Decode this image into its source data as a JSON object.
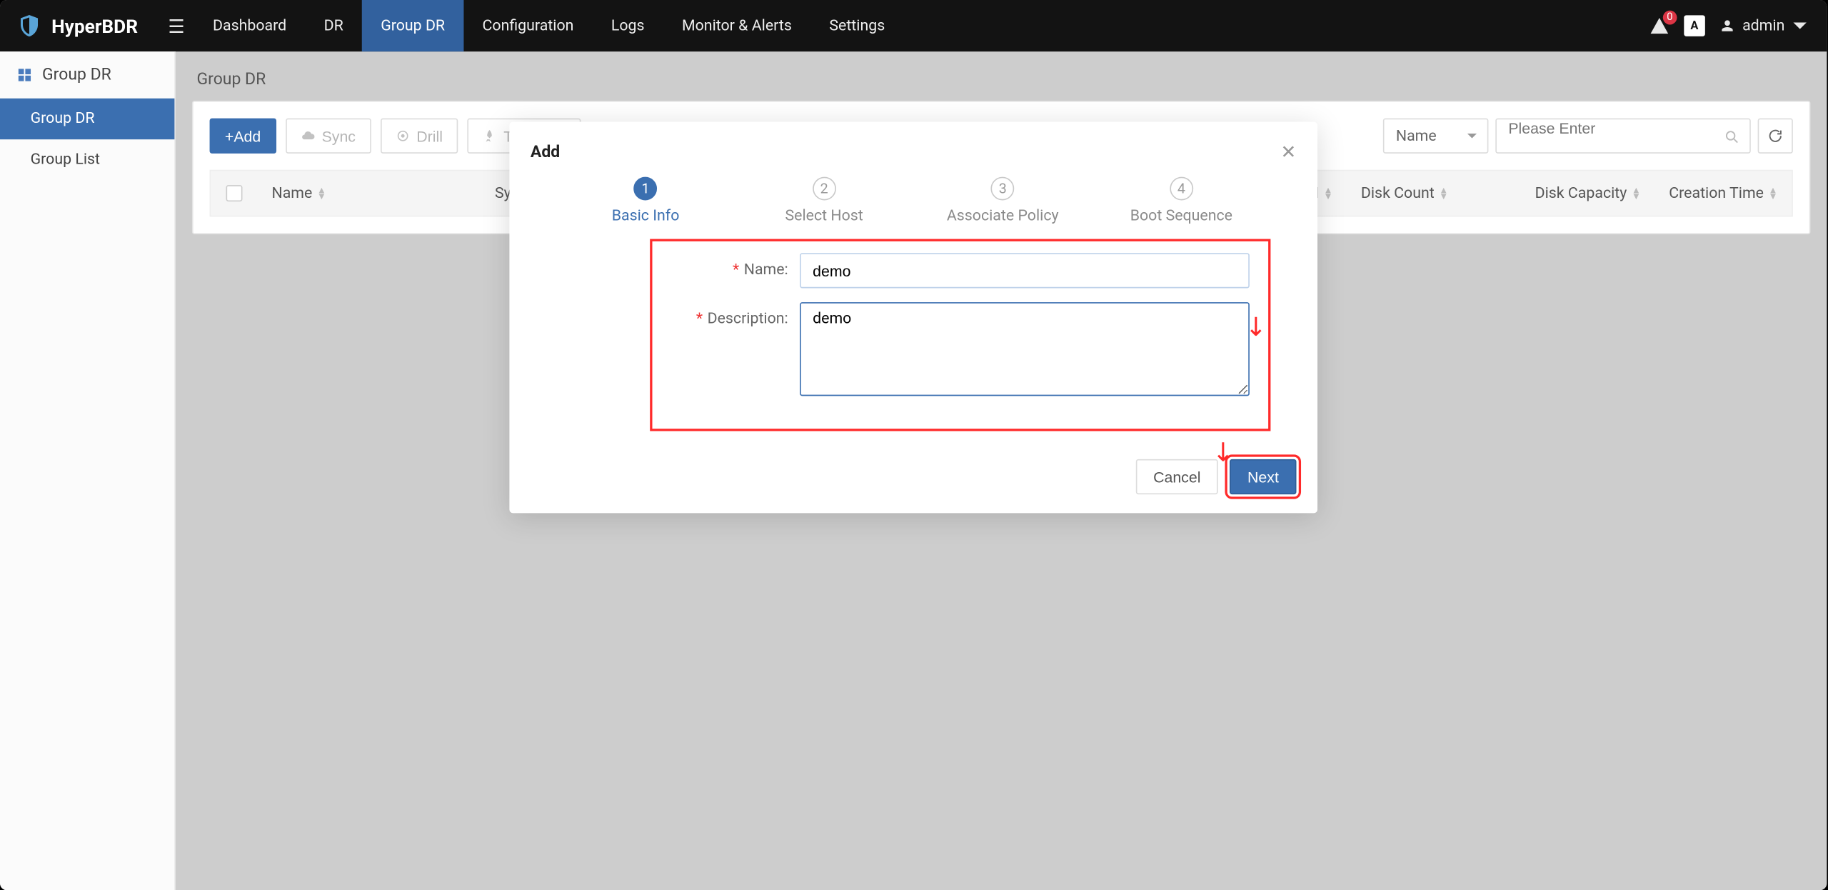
{
  "brand": "HyperBDR",
  "nav": {
    "items": [
      "Dashboard",
      "DR",
      "Group DR",
      "Configuration",
      "Logs",
      "Monitor & Alerts",
      "Settings"
    ],
    "activeIndex": 2
  },
  "topRight": {
    "alertCount": "0",
    "langLabel": "A",
    "user": "admin"
  },
  "sidebar": {
    "title": "Group DR",
    "items": [
      {
        "label": "Group DR",
        "active": true
      },
      {
        "label": "Group List",
        "active": false
      }
    ]
  },
  "page": {
    "title": "Group DR",
    "toolbar": {
      "add": "+Add",
      "sync": "Sync",
      "drill": "Drill",
      "takeover": "Takeover"
    },
    "search": {
      "selectLabel": "Name",
      "placeholder": "Please Enter"
    },
    "columns": {
      "name": "Name",
      "syncStatus": "Sync Status",
      "totalRam": "tal RAM",
      "diskCount": "Disk Count",
      "diskCapacity": "Disk Capacity",
      "creationTime": "Creation Time"
    }
  },
  "modal": {
    "title": "Add",
    "steps": [
      "Basic Info",
      "Select Host",
      "Associate Policy",
      "Boot Sequence"
    ],
    "activeStep": 0,
    "form": {
      "nameLabel": "Name:",
      "nameValue": "demo",
      "descLabel": "Description:",
      "descValue": "demo"
    },
    "buttons": {
      "cancel": "Cancel",
      "next": "Next"
    }
  }
}
